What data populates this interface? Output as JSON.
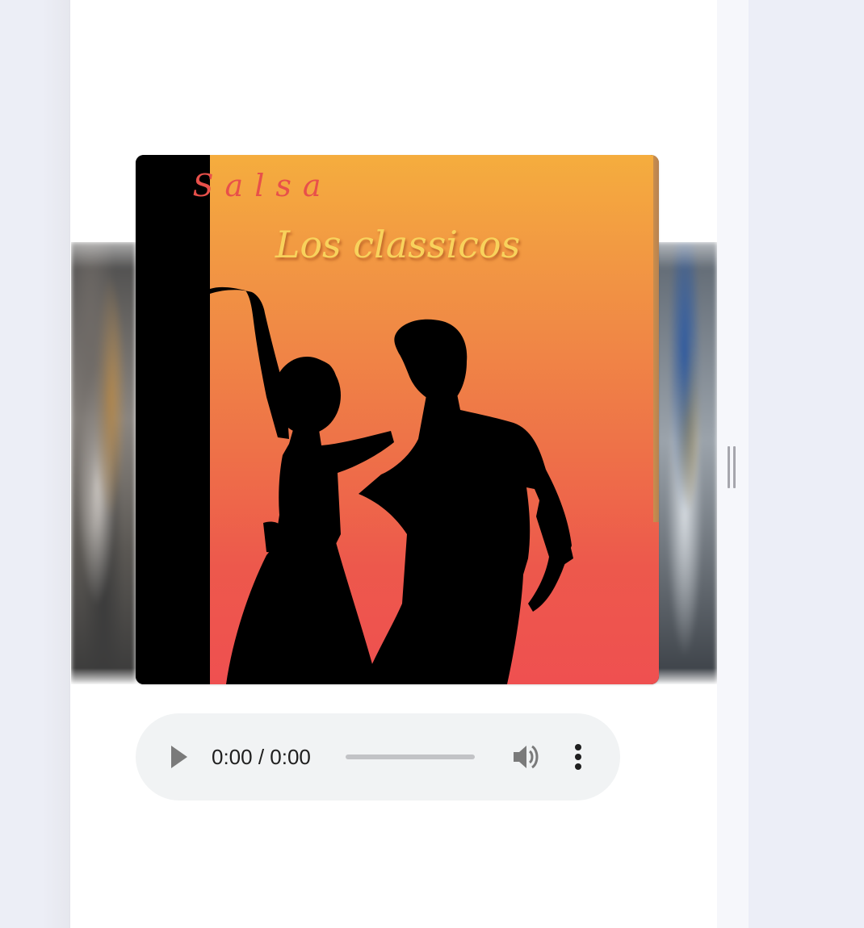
{
  "album": {
    "title": "Salsa",
    "subtitle": "Los classicos"
  },
  "player": {
    "time": "0:00 / 0:00",
    "progress_fraction": 0,
    "icons": {
      "play": "play-icon",
      "volume": "volume-icon",
      "more": "more-vert-icon"
    }
  },
  "colors": {
    "panel": "#ffffff",
    "page_background": "#eceef7",
    "player_background": "#f1f3f4",
    "cover_gradient_top": "#f5ad3e",
    "cover_gradient_bottom": "#ef5050",
    "title_color": "#e8504a",
    "subtitle_color": "#f8d25c"
  }
}
